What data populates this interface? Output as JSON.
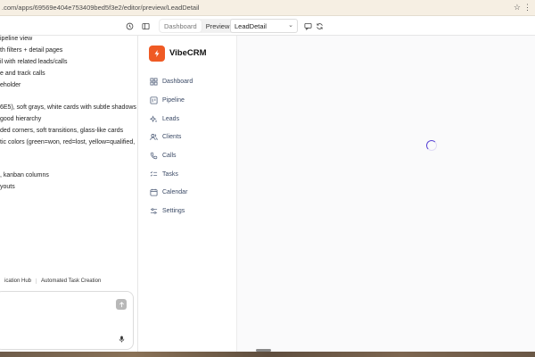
{
  "browser": {
    "url": ".com/apps/69569e404e753409bed5f3e2/editor/preview/LeadDetail"
  },
  "toolbar": {
    "view_tabs": [
      "Dashboard",
      "Preview"
    ],
    "active_tab": "Dashboard",
    "page_select_value": "LeadDetail"
  },
  "chat": {
    "lines": [
      "ipeline view",
      "th filters + detail pages",
      "il with related leads/calls",
      "e and track calls",
      "eholder",
      "6E5), soft grays, white cards with subtle shadows",
      "good hierarchy",
      "ded corners, soft transitions, glass-like cards",
      "tic colors (green=won, red=lost, yellow=qualified,",
      ", kanban columns",
      "youts"
    ],
    "tabs": [
      "ication Hub",
      "Automated Task Creation"
    ]
  },
  "crm": {
    "brand": "VibeCRM",
    "brand_color": "#ef5a24",
    "nav": [
      {
        "label": "Dashboard",
        "icon": "dashboard-grid-icon"
      },
      {
        "label": "Pipeline",
        "icon": "pipeline-icon"
      },
      {
        "label": "Leads",
        "icon": "sparkles-icon"
      },
      {
        "label": "Clients",
        "icon": "users-icon"
      },
      {
        "label": "Calls",
        "icon": "phone-icon"
      },
      {
        "label": "Tasks",
        "icon": "tasks-icon"
      },
      {
        "label": "Calendar",
        "icon": "calendar-icon"
      },
      {
        "label": "Settings",
        "icon": "settings-sliders-icon"
      }
    ]
  },
  "main": {
    "state": "loading",
    "spinner_color": "#5b46d6"
  }
}
